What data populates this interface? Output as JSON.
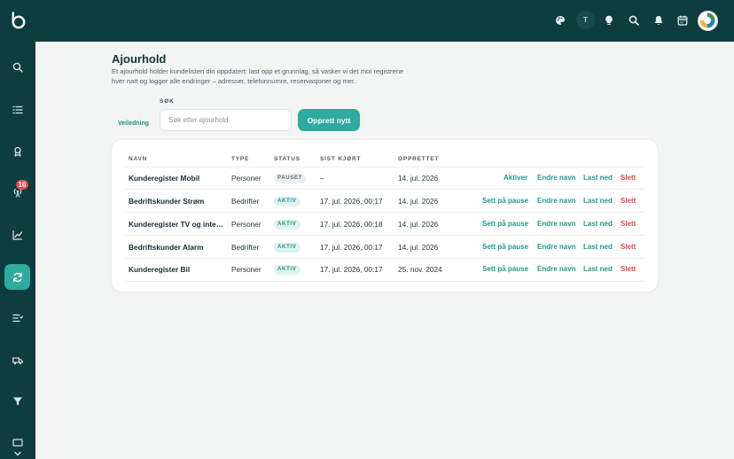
{
  "header": {
    "user_initial": "T"
  },
  "sidebar": {
    "notification_count": "16"
  },
  "page": {
    "title": "Ajourhold",
    "description": "Et ajourhold holder kundelisten din oppdatert: last opp et grunnlag, så vasker vi det mot registrene hver natt og logger alle endringer – adresser, telefonnumre, reservasjoner og mer."
  },
  "toolbar": {
    "guide_label": "Veiledning",
    "search_label": "SØK",
    "search_placeholder": "Søk etter ajourhold",
    "search_value": "",
    "create_label": "Opprett nytt"
  },
  "table": {
    "columns": [
      "NAVN",
      "TYPE",
      "STATUS",
      "SIST KJØRT",
      "OPPRETTET"
    ],
    "rows": [
      {
        "name": "Kunderegister Mobil",
        "type": "Personer",
        "status": "PAUSET",
        "last_run": "–",
        "created": "14. jul. 2026",
        "toggle": "Aktiver"
      },
      {
        "name": "Bedriftskunder Strøm",
        "type": "Bedrifter",
        "status": "AKTIV",
        "last_run": "17. jul. 2026, 00:17",
        "created": "14. jul. 2026",
        "toggle": "Sett på pause"
      },
      {
        "name": "Kunderegister TV og internett",
        "type": "Personer",
        "status": "AKTIV",
        "last_run": "17. jul. 2026, 00:18",
        "created": "14. jul. 2026",
        "toggle": "Sett på pause"
      },
      {
        "name": "Bedriftskunder Alarm",
        "type": "Bedrifter",
        "status": "AKTIV",
        "last_run": "17. jul. 2026, 00:17",
        "created": "14. jul. 2026",
        "toggle": "Sett på pause"
      },
      {
        "name": "Kunderegister Bil",
        "type": "Personer",
        "status": "AKTIV",
        "last_run": "17. jul. 2026, 00:17",
        "created": "25. nov. 2024",
        "toggle": "Sett på pause"
      }
    ],
    "action_rename": "Endre navn",
    "action_download": "Last ned",
    "action_delete": "Slett"
  },
  "colors": {
    "sidebar": "#0e3d3f",
    "accent": "#2faa9e",
    "danger": "#e04a4a",
    "background": "#f3f4f4"
  }
}
